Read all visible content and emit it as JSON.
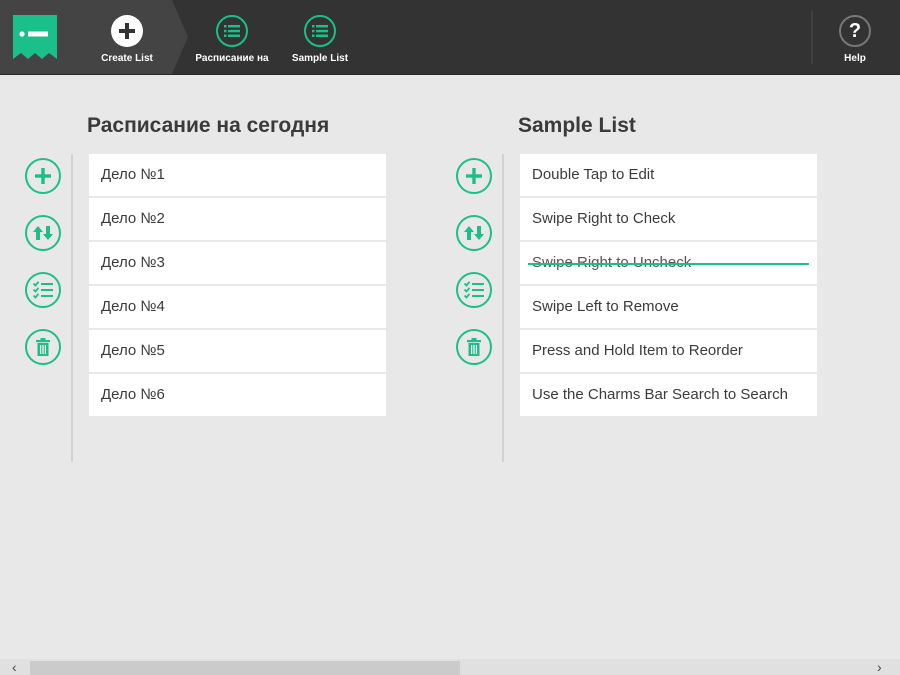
{
  "app": {
    "accent_color": "#1bbf8a",
    "logo_icon": "list-tag-icon"
  },
  "topbar": {
    "create_list": {
      "label": "Create List",
      "icon": "plus-icon"
    },
    "tabs": [
      {
        "label": "Расписание на",
        "icon": "list-icon"
      },
      {
        "label": "Sample List",
        "icon": "list-icon"
      }
    ],
    "help": {
      "label": "Help",
      "icon": "question-icon",
      "glyph": "?"
    }
  },
  "columns": [
    {
      "title": "Расписание на сегодня",
      "actions": [
        "add-icon",
        "sort-icon",
        "checklist-icon",
        "trash-icon"
      ],
      "items": [
        {
          "text": "Дело №1",
          "checked": false
        },
        {
          "text": "Дело №2",
          "checked": false
        },
        {
          "text": "Дело №3",
          "checked": false
        },
        {
          "text": "Дело №4",
          "checked": false
        },
        {
          "text": "Дело №5",
          "checked": false
        },
        {
          "text": "Дело №6",
          "checked": false
        }
      ]
    },
    {
      "title": "Sample List",
      "actions": [
        "add-icon",
        "sort-icon",
        "checklist-icon",
        "trash-icon"
      ],
      "items": [
        {
          "text": "Double Tap to Edit",
          "checked": false
        },
        {
          "text": "Swipe Right to Check",
          "checked": false
        },
        {
          "text": "Swipe Right to Uncheck",
          "checked": true
        },
        {
          "text": "Swipe Left to Remove",
          "checked": false
        },
        {
          "text": "Press and Hold Item to Reorder",
          "checked": false
        },
        {
          "text": "Use the Charms Bar Search to Search",
          "checked": false
        }
      ]
    }
  ],
  "scrollbar": {
    "left_arrow": "‹",
    "right_arrow": "›"
  }
}
